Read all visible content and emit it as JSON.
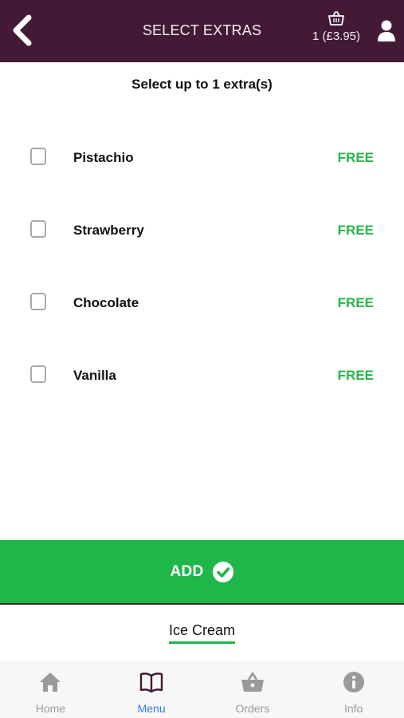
{
  "header": {
    "title": "SELECT EXTRAS",
    "basket_summary": "1 (£3.95)"
  },
  "instruction": "Select up to 1 extra(s)",
  "extras": [
    {
      "name": "Pistachio",
      "price": "FREE",
      "checked": false
    },
    {
      "name": "Strawberry",
      "price": "FREE",
      "checked": false
    },
    {
      "name": "Chocolate",
      "price": "FREE",
      "checked": false
    },
    {
      "name": "Vanilla",
      "price": "FREE",
      "checked": false
    }
  ],
  "add_button": {
    "label": "ADD"
  },
  "category": {
    "label": "Ice Cream"
  },
  "bottom_nav": [
    {
      "label": "Home",
      "icon": "home-icon",
      "active": false
    },
    {
      "label": "Menu",
      "icon": "book-icon",
      "active": true
    },
    {
      "label": "Orders",
      "icon": "basket-icon",
      "active": false
    },
    {
      "label": "Info",
      "icon": "info-icon",
      "active": false
    }
  ],
  "colors": {
    "header_bg": "#431a35",
    "accent_green": "#1fb74a",
    "price_green": "#27b54a",
    "nav_active": "#2f7fe0",
    "nav_inactive": "#9a9a9a",
    "menu_icon": "#431a35"
  }
}
